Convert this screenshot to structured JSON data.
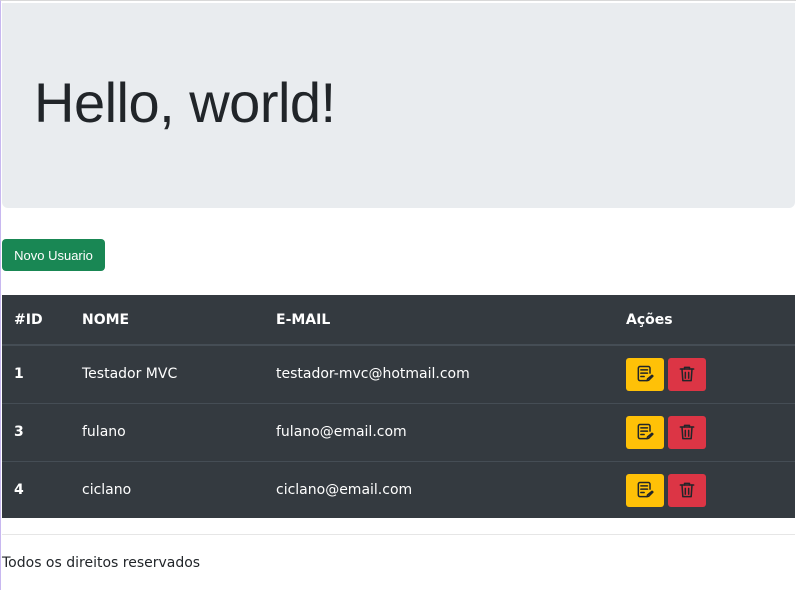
{
  "jumbotron": {
    "title": "Hello, world!"
  },
  "toolbar": {
    "new_user_label": "Novo Usuario"
  },
  "table": {
    "headers": {
      "id": "#ID",
      "nome": "NOME",
      "email": "E-MAIL",
      "acoes": "Ações"
    },
    "rows": [
      {
        "id": "1",
        "nome": "Testador MVC",
        "email": "testador-mvc@hotmail.com"
      },
      {
        "id": "3",
        "nome": "fulano",
        "email": "fulano@email.com"
      },
      {
        "id": "4",
        "nome": "ciclano",
        "email": "ciclano@email.com"
      }
    ],
    "actions": {
      "edit_icon": "edit-note-icon",
      "delete_icon": "trash-icon"
    }
  },
  "footer": {
    "text": "Todos os direitos reservados"
  },
  "colors": {
    "jumbotron_bg": "#e9ecef",
    "success": "#198754",
    "table_dark": "#343a40",
    "warning": "#ffc107",
    "danger": "#dc3545"
  }
}
